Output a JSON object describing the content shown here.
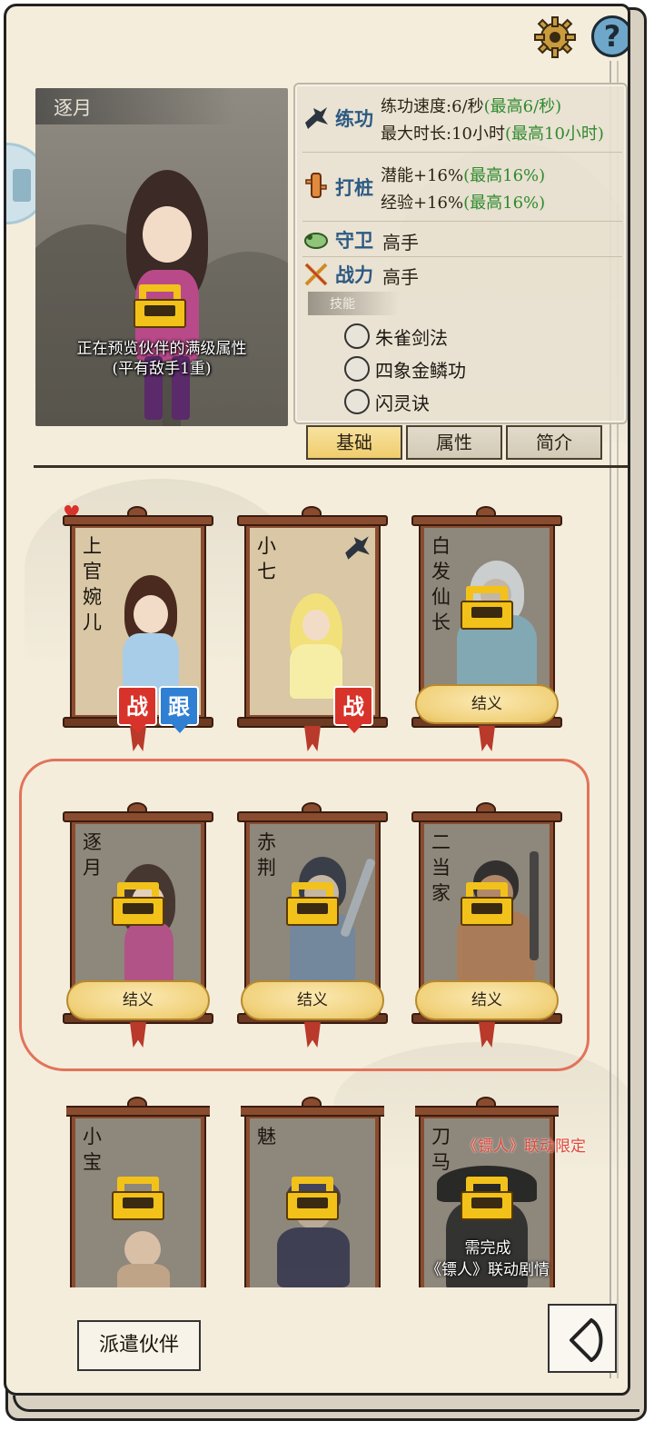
{
  "preview": {
    "name": "逐月",
    "note_line1": "正在预览伙伴的满级属性",
    "note_line2": "(平有敌手1重)"
  },
  "stats": {
    "practice": {
      "label": "练功",
      "speed_prefix": "练功速度:6/秒",
      "speed_max": "(最高6/秒)",
      "duration_prefix": "最大时长:10小时",
      "duration_max": "(最高10小时)"
    },
    "stake": {
      "label": "打桩",
      "potential_prefix": "潜能+16%",
      "potential_max": "(最高16%)",
      "exp_prefix": "经验+16%",
      "exp_max": "(最高16%)"
    },
    "guard": {
      "label": "守卫",
      "value": "高手"
    },
    "power": {
      "label": "战力",
      "value": "高手"
    },
    "skills_header": "技能",
    "skills": [
      "朱雀剑法",
      "四象金鳞功",
      "闪灵诀"
    ]
  },
  "tabs": [
    {
      "label": "基础",
      "active": true
    },
    {
      "label": "属性",
      "active": false
    },
    {
      "label": "简介",
      "active": false
    }
  ],
  "partners": [
    {
      "name": "上官婉儿",
      "badges": [
        "战",
        "跟"
      ],
      "locked": false
    },
    {
      "name": "小七",
      "badges": [
        "战"
      ],
      "locked": false
    },
    {
      "name": "白发仙长",
      "button": "结义",
      "locked": true
    },
    {
      "name": "逐月",
      "button": "结义",
      "locked": true
    },
    {
      "name": "赤荆",
      "button": "结义",
      "locked": true
    },
    {
      "name": "二当家",
      "button": "结义",
      "locked": true
    },
    {
      "name": "小宝",
      "locked": true
    },
    {
      "name": "魅",
      "locked": true
    },
    {
      "name": "刀马",
      "locked": true
    }
  ],
  "collab": {
    "tag": "《镖人》联动限定",
    "note_line1": "需完成",
    "note_line2": "《镖人》联动剧情"
  },
  "buttons": {
    "dispatch": "派遣伙伴"
  },
  "icons": {
    "settings": "gear-icon",
    "help": "question-icon",
    "back": "back-arrow-icon"
  },
  "colors": {
    "accent_gold": "#f2c21a",
    "scroll_wood": "#8a4c2e",
    "stat_label_blue": "#2c5a83",
    "max_green": "#2e8b2e",
    "highlight_outline": "#e2735a"
  }
}
